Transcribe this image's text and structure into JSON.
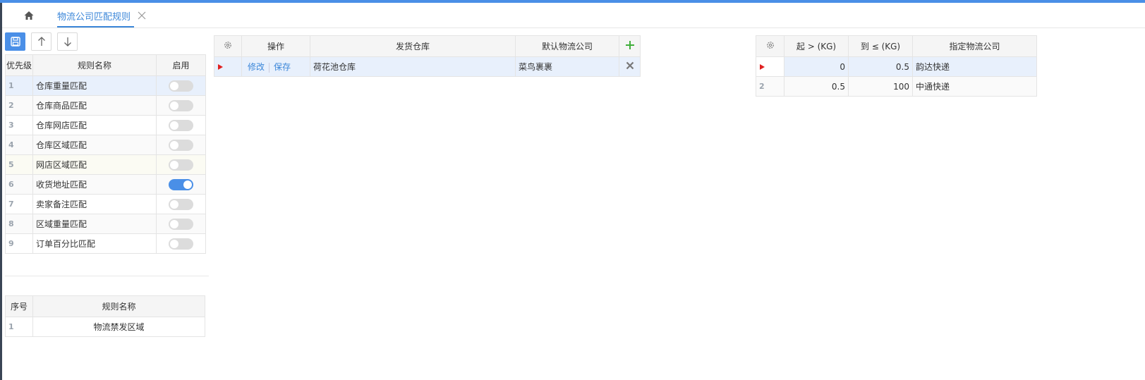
{
  "tab": {
    "title": "物流公司匹配规则"
  },
  "rules": {
    "headers": [
      "优先级",
      "规则名称",
      "启用"
    ],
    "rows": [
      {
        "priority": "1",
        "name": "仓库重量匹配",
        "enabled": false
      },
      {
        "priority": "2",
        "name": "仓库商品匹配",
        "enabled": false
      },
      {
        "priority": "3",
        "name": "仓库网店匹配",
        "enabled": false
      },
      {
        "priority": "4",
        "name": "仓库区域匹配",
        "enabled": false
      },
      {
        "priority": "5",
        "name": "网店区域匹配",
        "enabled": false
      },
      {
        "priority": "6",
        "name": "收货地址匹配",
        "enabled": true
      },
      {
        "priority": "7",
        "name": "卖家备注匹配",
        "enabled": false
      },
      {
        "priority": "8",
        "name": "区域重量匹配",
        "enabled": false
      },
      {
        "priority": "9",
        "name": "订单百分比匹配",
        "enabled": false
      }
    ]
  },
  "forbid": {
    "headers": [
      "序号",
      "规则名称"
    ],
    "rows": [
      {
        "index": "1",
        "name": "物流禁发区域"
      }
    ]
  },
  "warehouse": {
    "headers": [
      "操作",
      "发货仓库",
      "默认物流公司"
    ],
    "rows": [
      {
        "edit": "修改",
        "save": "保存",
        "warehouse": "荷花池仓库",
        "company": "菜鸟裹裹"
      }
    ]
  },
  "weight": {
    "headers": [
      "起 > (KG)",
      "到 ≤ (KG)",
      "指定物流公司"
    ],
    "rows": [
      {
        "index": "",
        "from": "0",
        "to": "0.5",
        "company": "韵达快递"
      },
      {
        "index": "2",
        "from": "0.5",
        "to": "100",
        "company": "中通快递"
      }
    ]
  },
  "colors": {
    "accent": "#4a8fe7",
    "marker": "#e02020",
    "add": "#3fae3a"
  },
  "icons": [
    "home-icon",
    "close-icon",
    "save-icon",
    "arrow-up-icon",
    "arrow-down-icon",
    "gear-icon",
    "add-icon",
    "delete-icon",
    "row-marker-icon"
  ]
}
